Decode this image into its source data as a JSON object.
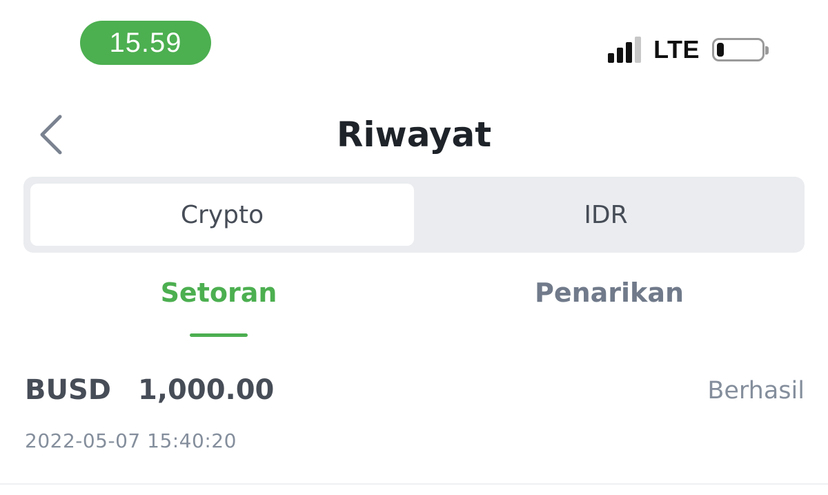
{
  "status_bar": {
    "time": "15.59",
    "network": "LTE",
    "signal_bars_active": 3,
    "signal_bars_total": 4,
    "battery_level": 0.15
  },
  "header": {
    "title": "Riwayat",
    "back_icon": "chevron-left-icon"
  },
  "segmented": {
    "items": [
      {
        "label": "Crypto",
        "active": true
      },
      {
        "label": "IDR",
        "active": false
      }
    ]
  },
  "subtabs": {
    "items": [
      {
        "label": "Setoran",
        "active": true
      },
      {
        "label": "Penarikan",
        "active": false
      }
    ]
  },
  "transactions": [
    {
      "coin": "BUSD",
      "amount": "1,000.00",
      "status": "Berhasil",
      "datetime": "2022-05-07 15:40:20"
    }
  ],
  "colors": {
    "accent_green": "#4caf50",
    "time_pill": "#4caf50",
    "segment_bg": "#eaecef",
    "text_primary": "#1e2329",
    "text_muted": "#848e9c",
    "signal_active": "#111111",
    "signal_inactive": "#c7c7c7",
    "battery_fill": "#111111"
  }
}
